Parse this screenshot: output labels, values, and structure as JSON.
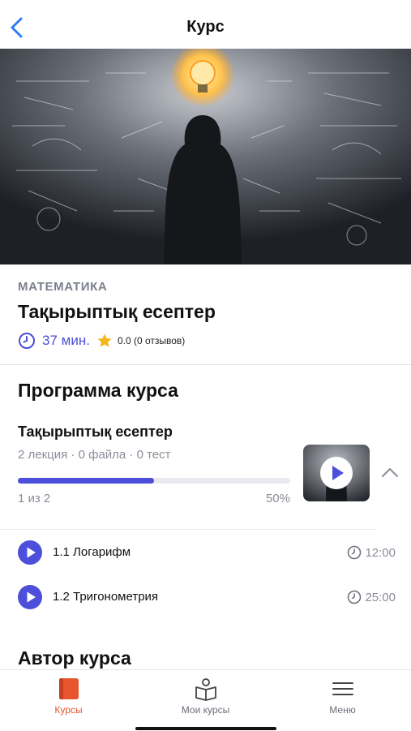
{
  "header": {
    "title": "Курс",
    "back_icon": "chevron-left-icon"
  },
  "course": {
    "category": "МАТЕМАТИКА",
    "title": "Тақырыптық есептер",
    "duration": "37 мин.",
    "rating": "0.0 (0 отзывов)",
    "accent_color": "#4b4fd9"
  },
  "program": {
    "heading": "Программа курса",
    "module": {
      "title": "Тақырыптық есептер",
      "stats": "2 лекция · 0 файла · 0 тест",
      "progress_fraction": 0.5,
      "progress_count": "1 из 2",
      "progress_percent": "50%"
    },
    "lessons": [
      {
        "name": "1.1 Логарифм",
        "time": "12:00"
      },
      {
        "name": "1.2 Тригонометрия",
        "time": "25:00"
      }
    ]
  },
  "author": {
    "heading": "Автор курса"
  },
  "tabbar": {
    "items": [
      {
        "label": "Курсы",
        "icon": "book-icon",
        "active": true
      },
      {
        "label": "Мои курсы",
        "icon": "reading-person-icon",
        "active": false
      },
      {
        "label": "Меню",
        "icon": "menu-icon",
        "active": false
      }
    ],
    "active_color": "#e8552f"
  }
}
